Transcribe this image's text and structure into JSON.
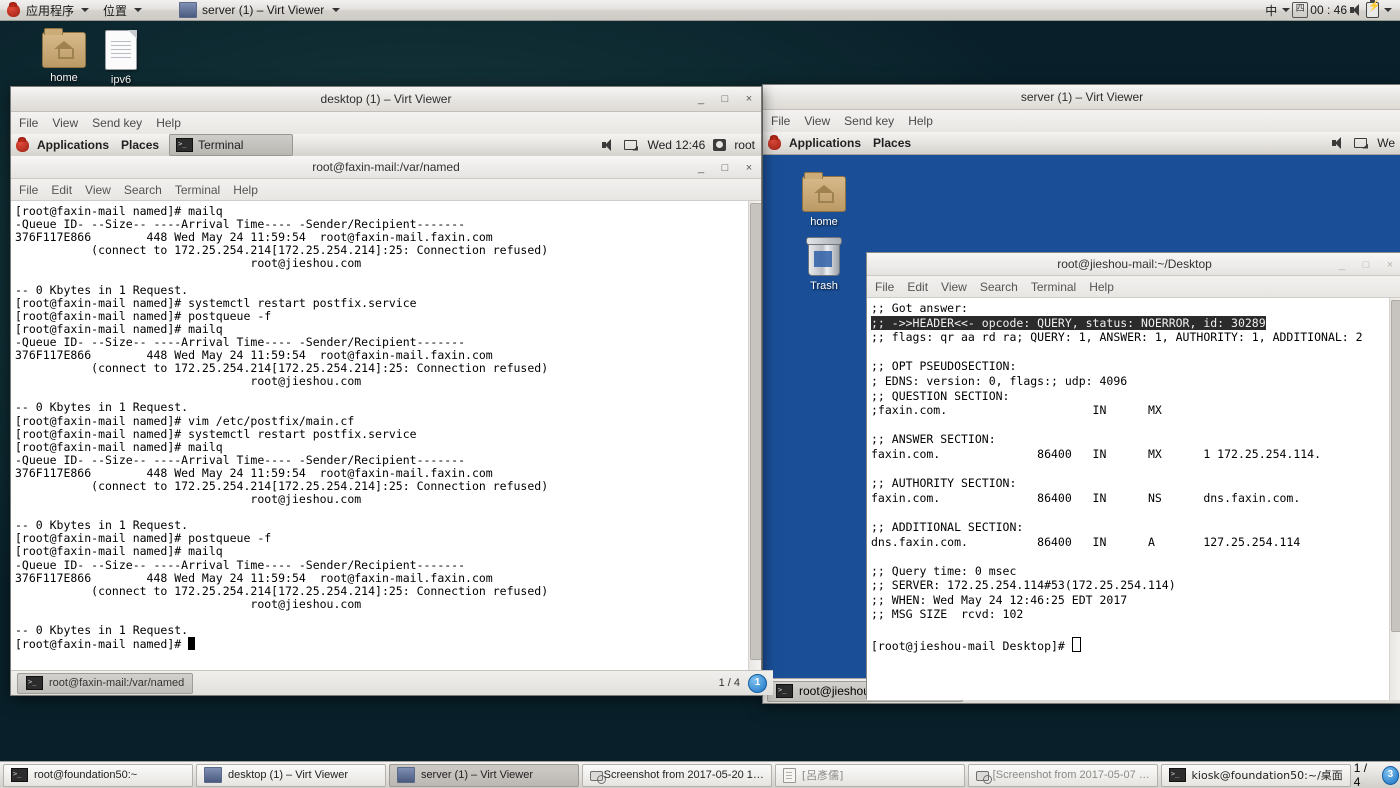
{
  "top_panel": {
    "applications_menu": "应用程序",
    "places_menu": "位置",
    "active_window": "server (1) – Virt Viewer",
    "input_method": "中",
    "calendar_glyph": "四",
    "clock": "00 : 46"
  },
  "desktop_icons": [
    {
      "label": "home",
      "icon": "home-folder-icon"
    },
    {
      "label": "ipv6",
      "icon": "text-file-icon"
    }
  ],
  "desktop_window": {
    "title": "desktop (1) – Virt Viewer",
    "menus": [
      "File",
      "View",
      "Send key",
      "Help"
    ],
    "buttons": {
      "minimize": "_",
      "maximize": "□",
      "close": "×"
    },
    "guest_panel": {
      "applications": "Applications",
      "places": "Places",
      "task": "Terminal",
      "clock": "Wed 12:46",
      "user": "root"
    },
    "terminal": {
      "title": "root@faxin-mail:/var/named",
      "menus": [
        "File",
        "Edit",
        "View",
        "Search",
        "Terminal",
        "Help"
      ],
      "lines": [
        "[root@faxin-mail named]# mailq",
        "-Queue ID- --Size-- ----Arrival Time---- -Sender/Recipient-------",
        "376F117E866        448 Wed May 24 11:59:54  root@faxin-mail.faxin.com",
        "           (connect to 172.25.254.214[172.25.254.214]:25: Connection refused)",
        "                                  root@jieshou.com",
        "",
        "-- 0 Kbytes in 1 Request.",
        "[root@faxin-mail named]# systemctl restart postfix.service",
        "[root@faxin-mail named]# postqueue -f",
        "[root@faxin-mail named]# mailq",
        "-Queue ID- --Size-- ----Arrival Time---- -Sender/Recipient-------",
        "376F117E866        448 Wed May 24 11:59:54  root@faxin-mail.faxin.com",
        "           (connect to 172.25.254.214[172.25.254.214]:25: Connection refused)",
        "                                  root@jieshou.com",
        "",
        "-- 0 Kbytes in 1 Request.",
        "[root@faxin-mail named]# vim /etc/postfix/main.cf",
        "[root@faxin-mail named]# systemctl restart postfix.service",
        "[root@faxin-mail named]# mailq",
        "-Queue ID- --Size-- ----Arrival Time---- -Sender/Recipient-------",
        "376F117E866        448 Wed May 24 11:59:54  root@faxin-mail.faxin.com",
        "           (connect to 172.25.254.214[172.25.254.214]:25: Connection refused)",
        "                                  root@jieshou.com",
        "",
        "-- 0 Kbytes in 1 Request.",
        "[root@faxin-mail named]# postqueue -f",
        "[root@faxin-mail named]# mailq",
        "-Queue ID- --Size-- ----Arrival Time---- -Sender/Recipient-------",
        "376F117E866        448 Wed May 24 11:59:54  root@faxin-mail.faxin.com",
        "           (connect to 172.25.254.214[172.25.254.214]:25: Connection refused)",
        "                                  root@jieshou.com",
        "",
        "-- 0 Kbytes in 1 Request.",
        "[root@faxin-mail named]# "
      ]
    },
    "statusbar": {
      "task": "root@faxin-mail:/var/named",
      "page": "1 / 4",
      "badge": "1"
    }
  },
  "server_window": {
    "title": "server (1) – Virt Viewer",
    "menus": [
      "File",
      "View",
      "Send key",
      "Help"
    ],
    "guest_panel": {
      "applications": "Applications",
      "places": "Places",
      "clock": "We"
    },
    "desktop_icons": [
      {
        "label": "home",
        "icon": "home-folder-icon"
      },
      {
        "label": "Trash",
        "icon": "trash-icon"
      }
    ],
    "terminal": {
      "title": "root@jieshou-mail:~/Desktop",
      "menus": [
        "File",
        "Edit",
        "View",
        "Search",
        "Terminal",
        "Help"
      ],
      "lines": [
        {
          "text": ";; Got answer:",
          "highlight": false
        },
        {
          "text": ";; ->>HEADER<<- opcode: QUERY, status: NOERROR, id: 30289",
          "highlight": true
        },
        {
          "text": ";; flags: qr aa rd ra; QUERY: 1, ANSWER: 1, AUTHORITY: 1, ADDITIONAL: 2",
          "highlight": false
        },
        {
          "text": "",
          "highlight": false
        },
        {
          "text": ";; OPT PSEUDOSECTION:",
          "highlight": false
        },
        {
          "text": "; EDNS: version: 0, flags:; udp: 4096",
          "highlight": false
        },
        {
          "text": ";; QUESTION SECTION:",
          "highlight": false
        },
        {
          "text": ";faxin.com.                     IN      MX",
          "highlight": false
        },
        {
          "text": "",
          "highlight": false
        },
        {
          "text": ";; ANSWER SECTION:",
          "highlight": false
        },
        {
          "text": "faxin.com.              86400   IN      MX      1 172.25.254.114.",
          "highlight": false
        },
        {
          "text": "",
          "highlight": false
        },
        {
          "text": ";; AUTHORITY SECTION:",
          "highlight": false
        },
        {
          "text": "faxin.com.              86400   IN      NS      dns.faxin.com.",
          "highlight": false
        },
        {
          "text": "",
          "highlight": false
        },
        {
          "text": ";; ADDITIONAL SECTION:",
          "highlight": false
        },
        {
          "text": "dns.faxin.com.          86400   IN      A       127.25.254.114",
          "highlight": false
        },
        {
          "text": "",
          "highlight": false
        },
        {
          "text": ";; Query time: 0 msec",
          "highlight": false
        },
        {
          "text": ";; SERVER: 172.25.254.114#53(172.25.254.114)",
          "highlight": false
        },
        {
          "text": ";; WHEN: Wed May 24 12:46:25 EDT 2017",
          "highlight": false
        },
        {
          "text": ";; MSG SIZE  rcvd: 102",
          "highlight": false
        },
        {
          "text": "",
          "highlight": false
        },
        {
          "text": "[root@jieshou-mail Desktop]# ",
          "highlight": false
        }
      ]
    },
    "statusbar": {
      "task": "root@jieshou-mail:~/Desktop"
    }
  },
  "taskbar": {
    "buttons": [
      {
        "label": "root@foundation50:~",
        "icon": "terminal-icon",
        "active": false,
        "dim": false
      },
      {
        "label": "desktop (1) – Virt Viewer",
        "icon": "screen-icon",
        "active": false,
        "dim": false
      },
      {
        "label": "server (1) – Virt Viewer",
        "icon": "screen-icon",
        "active": true,
        "dim": false
      },
      {
        "label": "Screenshot from 2017-05-20 1…",
        "icon": "image-viewer-icon",
        "active": false,
        "dim": false
      },
      {
        "label": "[呂彥儒]",
        "icon": "document-icon",
        "active": false,
        "dim": true
      },
      {
        "label": "[Screenshot from 2017-05-07 …",
        "icon": "image-viewer-icon",
        "active": false,
        "dim": true
      },
      {
        "label": "kiosk@foundation50:~/桌面",
        "icon": "terminal-icon",
        "active": false,
        "dim": false
      }
    ],
    "workspace": "1 / 4",
    "badge": "3"
  },
  "colors": {
    "guest_desktop_blue": "#1a4f97",
    "panel_grey": "#e4e2de",
    "terminal_bg": "#ffffff",
    "highlight_bg": "#2b2b2b"
  }
}
